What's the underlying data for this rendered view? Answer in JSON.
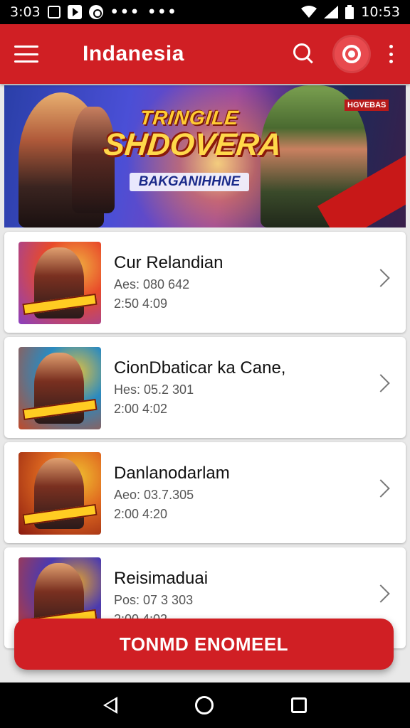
{
  "status_bar": {
    "time_left": "3:03",
    "time_right": "10:53",
    "dots": "•••",
    "dots2": "•••"
  },
  "app_bar": {
    "title": "Indanesia",
    "icons": [
      "hamburger-menu-icon",
      "search-icon",
      "profile-icon",
      "more-vert-icon"
    ]
  },
  "banner": {
    "title_line1": "TRINGILE",
    "title_line2": "SHDOVERA",
    "subtitle": "BAKGANIHHNE",
    "tag": "HGVEBAS"
  },
  "list": {
    "items": [
      {
        "title": "Cur Relandian",
        "line1": "Aes: 080 642",
        "line2": "2:50 4:09",
        "colors": [
          "#e84a2a",
          "#8a3fc0",
          "#f0b040"
        ]
      },
      {
        "title": "CionDbaticar ka Cane,",
        "line1": "Hes: 05.2 301",
        "line2": "2:00 4:02",
        "colors": [
          "#2a8ac0",
          "#c04a2a",
          "#e0c040"
        ]
      },
      {
        "title": "Danlanodarlam",
        "line1": "Aeo: 03.7.305",
        "line2": "2:00 4:20",
        "colors": [
          "#e06a20",
          "#8a1a10",
          "#f0c030"
        ]
      },
      {
        "title": "Reisimaduai",
        "line1": "Pos: 07 3 303",
        "line2": "2:00 4:02",
        "colors": [
          "#4a3ab0",
          "#c83a2a",
          "#e0a030"
        ]
      }
    ]
  },
  "fab": {
    "label": "TONMD ENOMEEL"
  },
  "colors": {
    "accent": "#d01f24",
    "background": "#e9e9e9"
  }
}
